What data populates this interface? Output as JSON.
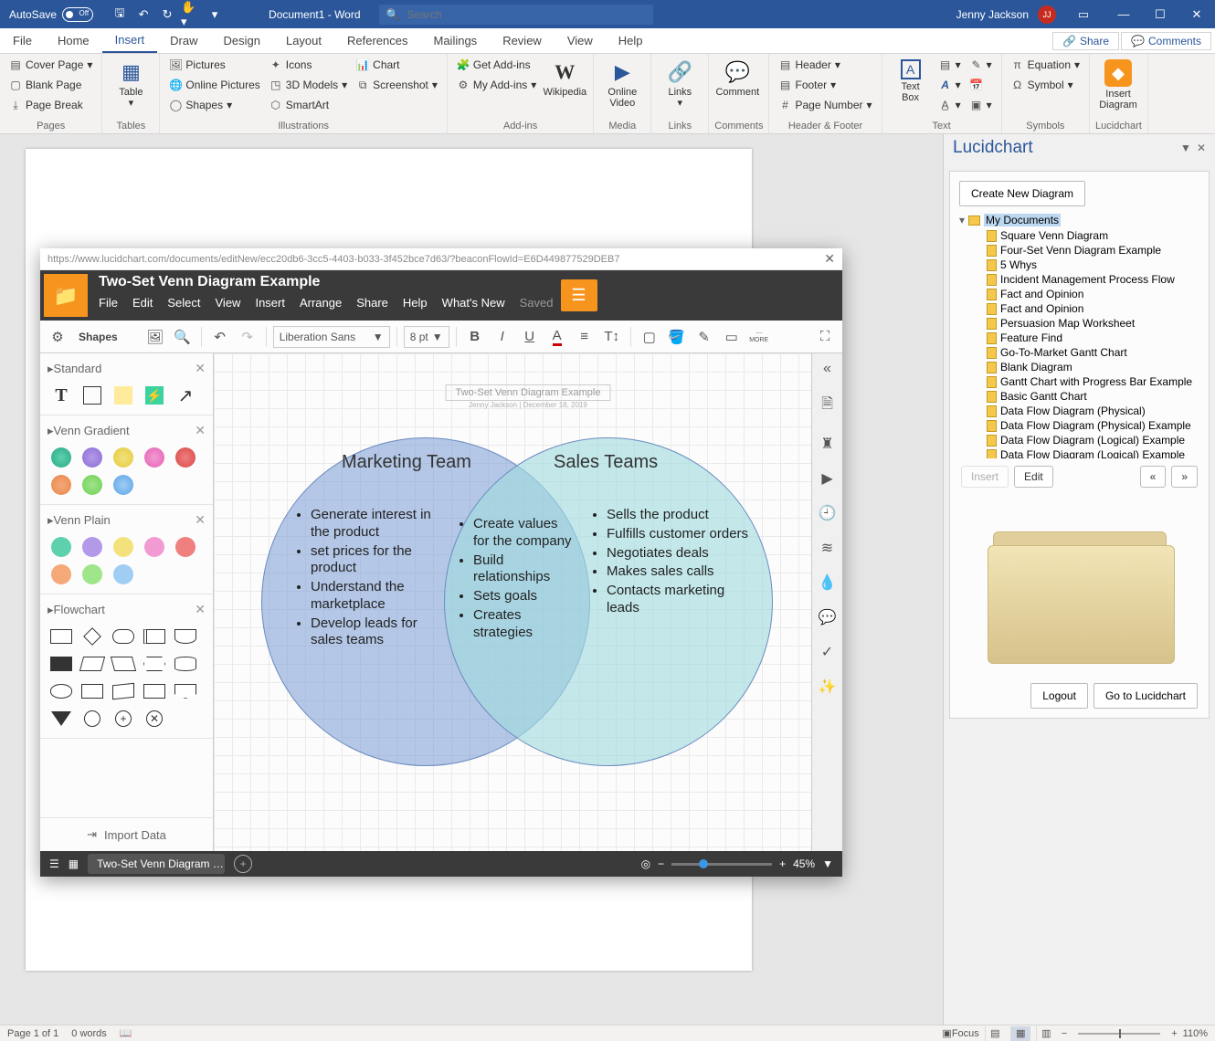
{
  "titlebar": {
    "autosave": "AutoSave",
    "autosave_state": "Off",
    "doc_title": "Document1 - Word",
    "search_placeholder": "Search",
    "user_name": "Jenny Jackson",
    "user_initials": "JJ"
  },
  "tabs": [
    "File",
    "Home",
    "Insert",
    "Draw",
    "Design",
    "Layout",
    "References",
    "Mailings",
    "Review",
    "View",
    "Help"
  ],
  "active_tab": "Insert",
  "share_label": "Share",
  "comments_label": "Comments",
  "ribbon": {
    "pages": {
      "label": "Pages",
      "cover": "Cover Page",
      "blank": "Blank Page",
      "pbreak": "Page Break"
    },
    "tables": {
      "label": "Tables",
      "table": "Table"
    },
    "illustr": {
      "label": "Illustrations",
      "pictures": "Pictures",
      "online": "Online Pictures",
      "shapes": "Shapes",
      "icons": "Icons",
      "models": "3D Models",
      "smart": "SmartArt",
      "chart": "Chart",
      "screen": "Screenshot"
    },
    "addins": {
      "label": "Add-ins",
      "get": "Get Add-ins",
      "my": "My Add-ins",
      "wiki": "Wikipedia"
    },
    "media": {
      "label": "Media",
      "video": "Online\nVideo"
    },
    "links": {
      "label": "Links",
      "links": "Links"
    },
    "comments": {
      "label": "Comments",
      "comment": "Comment"
    },
    "hf": {
      "label": "Header & Footer",
      "header": "Header",
      "footer": "Footer",
      "pagenum": "Page Number"
    },
    "text": {
      "label": "Text",
      "textbox": "Text\nBox"
    },
    "symbols": {
      "label": "Symbols",
      "equation": "Equation",
      "symbol": "Symbol"
    },
    "lucid_rib": {
      "label": "Lucidchart",
      "insert_diag": "Insert\nDiagram"
    }
  },
  "lucid_panel": {
    "title": "Lucidchart",
    "create_btn": "Create New Diagram",
    "root": "My Documents",
    "docs": [
      "Square Venn Diagram",
      "Four-Set Venn Diagram Example",
      "5 Whys",
      "Incident Management Process Flow",
      "Fact and Opinion",
      "Fact and Opinion",
      "Persuasion Map Worksheet",
      "Feature Find",
      "Go-To-Market Gantt Chart",
      "Blank Diagram",
      "Gantt Chart with Progress Bar Example",
      "Basic Gantt Chart",
      "Data Flow Diagram (Physical)",
      "Data Flow Diagram (Physical) Example",
      "Data Flow Diagram (Logical) Example",
      "Data Flow Diagram (Logical) Example"
    ],
    "edit_btn": "Edit",
    "prev": "«",
    "next": "»",
    "logout": "Logout",
    "goto": "Go to Lucidchart"
  },
  "lucid_window": {
    "url": "https://www.lucidchart.com/documents/editNew/ecc20db6-3cc5-4403-b033-3f452bce7d63/?beaconFlowId=E6D449877529DEB7",
    "title": "Two-Set Venn Diagram Example",
    "menu": [
      "File",
      "Edit",
      "Select",
      "View",
      "Insert",
      "Arrange",
      "Share",
      "Help",
      "What's New"
    ],
    "saved": "Saved",
    "shapes_label": "Shapes",
    "font": "Liberation Sans",
    "fontsize": "8 pt",
    "dots_label": "MORE",
    "sidebar": {
      "standard": "Standard",
      "venn_grad": "Venn Gradient",
      "venn_plain": "Venn Plain",
      "flowchart": "Flowchart",
      "import": "Import Data"
    },
    "status": {
      "tab": "Two-Set Venn Diagram …",
      "zoom": "45%"
    }
  },
  "venn": {
    "canvas_title": "Two-Set Venn Diagram Example",
    "canvas_sub": "Jenny Jackson  |  December 18, 2019",
    "left_title": "Marketing Team",
    "right_title": "Sales Teams",
    "left_items": [
      "Generate interest in the product",
      "set prices for the product",
      "Understand the marketplace",
      "Develop leads for sales teams"
    ],
    "center_items": [
      "Create values for the company",
      "Build relationships",
      "Sets goals",
      "Creates strategies"
    ],
    "right_items": [
      "Sells the product",
      "Fulfills customer orders",
      "Negotiates deals",
      "Makes sales calls",
      "Contacts marketing leads"
    ]
  },
  "word_status": {
    "page": "Page 1 of 1",
    "words": "0 words",
    "focus": "Focus",
    "zoom": "110%"
  },
  "colors": {
    "word_blue": "#2b579a",
    "lucid_orange": "#f7941e"
  }
}
